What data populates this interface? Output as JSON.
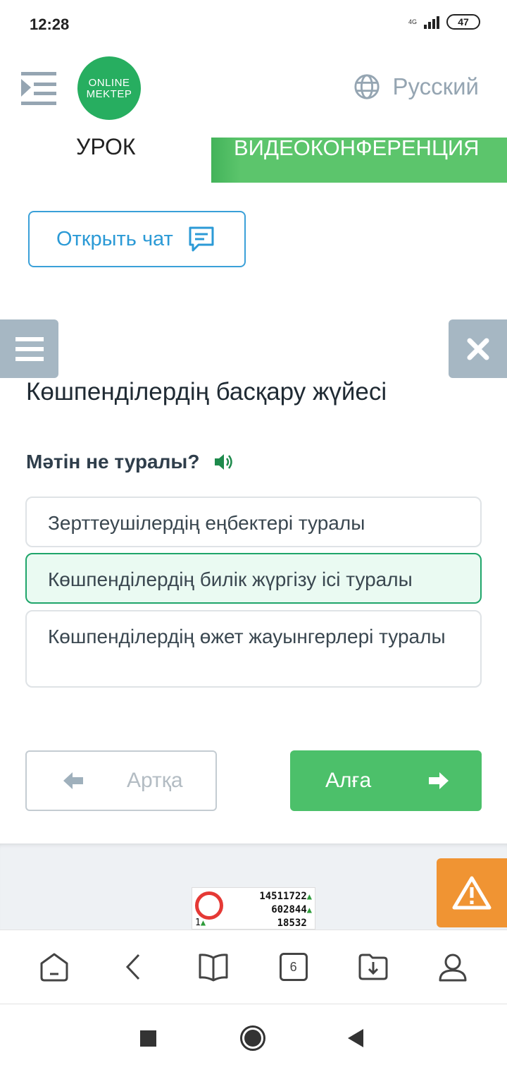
{
  "status_bar": {
    "time": "12:28",
    "network": "4G",
    "battery": "47"
  },
  "header": {
    "logo_line1": "ONLINE",
    "logo_line2": "MEKTEP",
    "language": "Русский",
    "tab_lesson": "УРОК",
    "tab_video": "ВИДЕОКОНФЕРЕНЦИЯ"
  },
  "chat_button": {
    "label": "Открыть чат"
  },
  "lesson": {
    "title": "Көшпенділердің басқару жүйесі",
    "question": "Мәтін не туралы?",
    "options": [
      {
        "text": "Зерттеушілердің еңбектері туралы",
        "selected": false
      },
      {
        "text": "Көшпенділердің билік жүргізу ісі туралы",
        "selected": true
      },
      {
        "text": "Көшпенділердің өжет жауынгерлері туралы",
        "selected": false
      }
    ]
  },
  "navigation": {
    "back_label": "Артқа",
    "next_label": "Алға"
  },
  "counter_widget": {
    "small": "1",
    "values": [
      "14511722",
      "602844",
      "18532"
    ]
  },
  "bottom_nav": {
    "tab_count": "6"
  },
  "colors": {
    "accent_green": "#4cc06a",
    "accent_blue": "#2b9ad6",
    "warning": "#f09433",
    "side_buttons": "#a6b7c3"
  }
}
